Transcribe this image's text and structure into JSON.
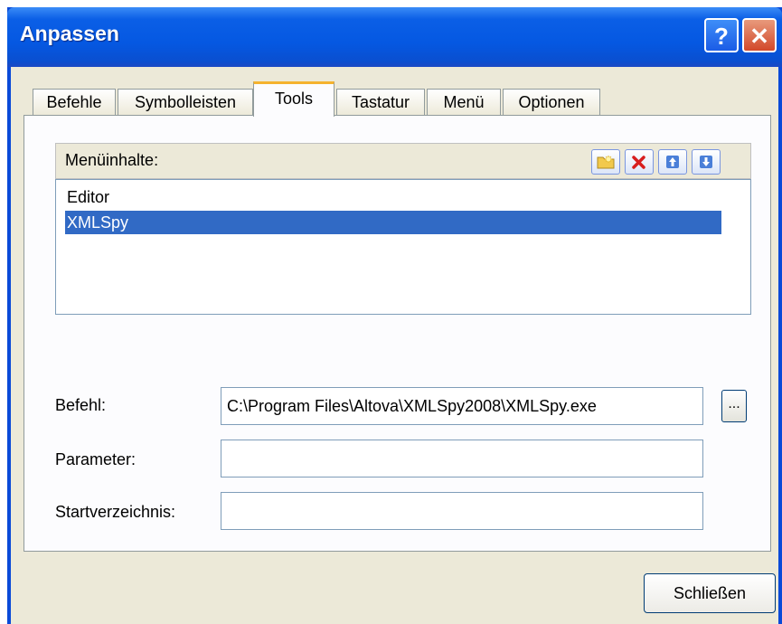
{
  "window": {
    "title": "Anpassen"
  },
  "titlebar": {
    "help_glyph": "?",
    "close_glyph": "✕"
  },
  "tabs": [
    {
      "label": "Befehle",
      "active": false
    },
    {
      "label": "Symbolleisten",
      "active": false
    },
    {
      "label": "Tools",
      "active": true
    },
    {
      "label": "Tastatur",
      "active": false
    },
    {
      "label": "Menü",
      "active": false
    },
    {
      "label": "Optionen",
      "active": false
    }
  ],
  "menu_contents": {
    "label": "Menüinhalte:",
    "toolbar": [
      {
        "name": "new-folder-icon"
      },
      {
        "name": "delete-icon"
      },
      {
        "name": "move-up-icon"
      },
      {
        "name": "move-down-icon"
      }
    ],
    "items": [
      {
        "label": "Editor",
        "selected": false
      },
      {
        "label": "XMLSpy",
        "selected": true
      }
    ]
  },
  "fields": {
    "command": {
      "label": "Befehl:",
      "value": "C:\\Program Files\\Altova\\XMLSpy2008\\XMLSpy.exe"
    },
    "parameter": {
      "label": "Parameter:",
      "value": ""
    },
    "start_dir": {
      "label": "Startverzeichnis:",
      "value": ""
    }
  },
  "browse_label": "...",
  "close_button": "Schließen",
  "colors": {
    "titlebar": "#0558e2",
    "selection": "#316ac5",
    "dialog_bg": "#ece9d8",
    "active_tab_accent": "#f5b32e"
  }
}
